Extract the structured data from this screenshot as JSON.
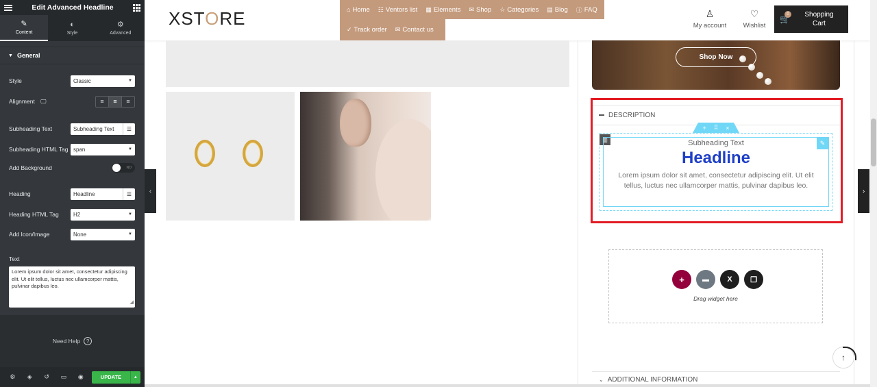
{
  "panel": {
    "title": "Edit Advanced Headline",
    "tabs": [
      {
        "label": "Content",
        "icon": "pencil-icon"
      },
      {
        "label": "Style",
        "icon": "contrast-icon"
      },
      {
        "label": "Advanced",
        "icon": "gear-icon"
      }
    ],
    "section_title": "General",
    "fields": {
      "style_label": "Style",
      "style_value": "Classic",
      "alignment_label": "Alignment",
      "subheading_text_label": "Subheading Text",
      "subheading_text_value": "Subheading Text",
      "subheading_tag_label": "Subheading HTML Tag",
      "subheading_tag_value": "span",
      "add_background_label": "Add Background",
      "add_background_toggle": "NO",
      "heading_label": "Heading",
      "heading_value": "Headline",
      "heading_tag_label": "Heading HTML Tag",
      "heading_tag_value": "H2",
      "add_icon_label": "Add Icon/Image",
      "add_icon_value": "None",
      "text_label": "Text",
      "text_value": "Lorem ipsum dolor sit amet, consectetur adipiscing elit. Ut elit tellus, luctus nec ullamcorper mattis, pulvinar dapibus leo."
    },
    "help_label": "Need Help",
    "update_label": "UPDATE"
  },
  "header": {
    "logo_text_a": "XST",
    "logo_text_b": "O",
    "logo_text_c": "RE",
    "nav_row1": [
      {
        "label": "Home",
        "icon": "home-icon"
      },
      {
        "label": "Ventors list",
        "icon": "list-icon"
      },
      {
        "label": "Elements",
        "icon": "grid-icon"
      },
      {
        "label": "Shop",
        "icon": "gift-icon"
      },
      {
        "label": "Categories",
        "icon": "star-icon"
      },
      {
        "label": "Blog",
        "icon": "calendar-icon"
      },
      {
        "label": "FAQ",
        "icon": "question-icon"
      }
    ],
    "nav_row2": [
      {
        "label": "Track order",
        "icon": "check-circle-icon"
      },
      {
        "label": "Contact us",
        "icon": "envelope-icon"
      }
    ],
    "account_label": "My account",
    "wishlist_label": "Wishlist",
    "cart_label_line1": "Shopping",
    "cart_label_line2": "Cart",
    "cart_badge": "0"
  },
  "content": {
    "shop_now_label": "Shop Now",
    "description_label": "DESCRIPTION",
    "widget": {
      "subheading": "Subheading Text",
      "headline": "Headline",
      "text": "Lorem ipsum dolor sit amet, consectetur adipiscing elit. Ut elit tellus, luctus nec ullamcorper mattis, pulvinar dapibus leo."
    },
    "drag_widget_label": "Drag widget here",
    "additional_info_label": "ADDITIONAL INFORMATION"
  },
  "colors": {
    "nav_bg": "#c49a7c",
    "headline": "#1e3fc7",
    "highlight_frame": "#e31b23",
    "update_btn": "#39b54a",
    "editor_accent": "#71d7f7"
  }
}
